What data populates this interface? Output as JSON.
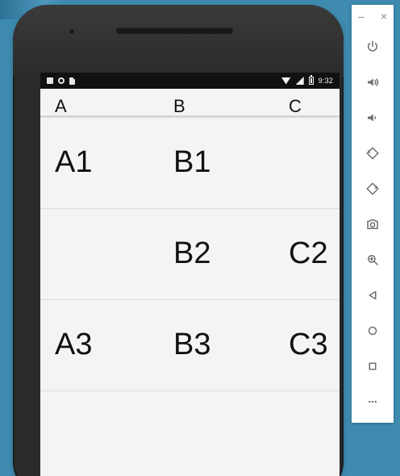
{
  "table": {
    "headers": [
      "A",
      "B",
      "C"
    ],
    "rows": [
      [
        "A1",
        "B1",
        ""
      ],
      [
        "",
        "B2",
        "C2"
      ],
      [
        "A3",
        "B3",
        "C3"
      ]
    ]
  },
  "status_bar": {
    "time": "9:32"
  },
  "emulator_toolbar": {
    "top_minimize": "–",
    "top_close": "×",
    "buttons": [
      "power",
      "volume-up",
      "volume-down",
      "rotate-left",
      "rotate-right",
      "camera",
      "zoom",
      "back",
      "home",
      "overview",
      "more"
    ]
  }
}
